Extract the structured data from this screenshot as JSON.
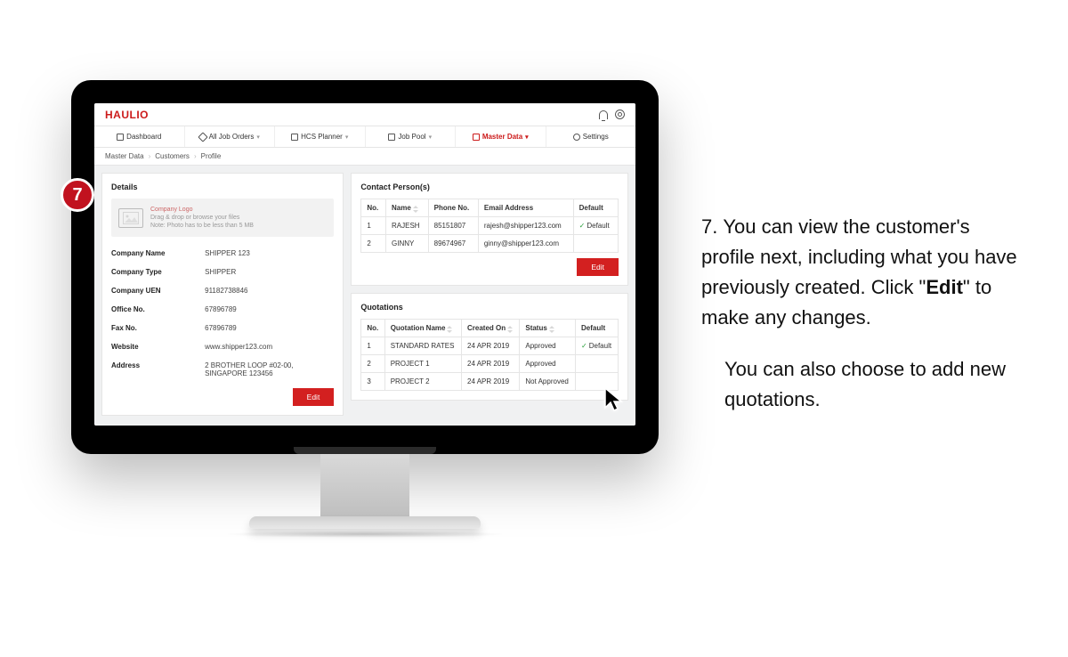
{
  "brand": "HAULIO",
  "nav": {
    "dashboard": "Dashboard",
    "job_orders": "All Job Orders",
    "hcs": "HCS Planner",
    "job_pool": "Job Pool",
    "master_data": "Master Data",
    "settings": "Settings"
  },
  "breadcrumb": {
    "a": "Master Data",
    "b": "Customers",
    "c": "Profile"
  },
  "details": {
    "title": "Details",
    "logo": {
      "line1": "Company Logo",
      "line2": "Drag & drop or browse your files",
      "line3": "Note: Photo has to be less than 5 MB"
    },
    "fields": {
      "company_name": {
        "k": "Company Name",
        "v": "SHIPPER 123"
      },
      "company_type": {
        "k": "Company Type",
        "v": "SHIPPER"
      },
      "company_uen": {
        "k": "Company UEN",
        "v": "91182738846"
      },
      "office_no": {
        "k": "Office No.",
        "v": "67896789"
      },
      "fax_no": {
        "k": "Fax No.",
        "v": "67896789"
      },
      "website": {
        "k": "Website",
        "v": "www.shipper123.com"
      },
      "address": {
        "k": "Address",
        "v": "2 BROTHER LOOP #02-00, SINGAPORE 123456"
      }
    },
    "edit": "Edit"
  },
  "contacts": {
    "title": "Contact Person(s)",
    "headers": {
      "no": "No.",
      "name": "Name",
      "phone": "Phone No.",
      "email": "Email Address",
      "def": "Default"
    },
    "rows": [
      {
        "no": "1",
        "name": "RAJESH",
        "phone": "85151807",
        "email": "rajesh@shipper123.com",
        "def": "Default",
        "is_default": true
      },
      {
        "no": "2",
        "name": "GINNY",
        "phone": "89674967",
        "email": "ginny@shipper123.com",
        "def": "",
        "is_default": false
      }
    ],
    "edit": "Edit"
  },
  "quotations": {
    "title": "Quotations",
    "headers": {
      "no": "No.",
      "name": "Quotation Name",
      "created": "Created On",
      "status": "Status",
      "def": "Default"
    },
    "rows": [
      {
        "no": "1",
        "name": "STANDARD RATES",
        "created": "24 APR 2019",
        "status": "Approved",
        "approved": true,
        "def": "Default",
        "is_default": true
      },
      {
        "no": "2",
        "name": "PROJECT 1",
        "created": "24 APR 2019",
        "status": "Approved",
        "approved": true,
        "def": "",
        "is_default": false
      },
      {
        "no": "3",
        "name": "PROJECT 2",
        "created": "24 APR 2019",
        "status": "Not Approved",
        "approved": false,
        "def": "",
        "is_default": false
      }
    ]
  },
  "step": {
    "number": "7"
  },
  "instruction": {
    "line1_num": "7.",
    "line1": "You can view the customer's profile next, including what you have previously created. Click \"",
    "line1_bold": "Edit",
    "line1_after": "\" to make any changes.",
    "line2": "You can also choose to add new quotations."
  }
}
